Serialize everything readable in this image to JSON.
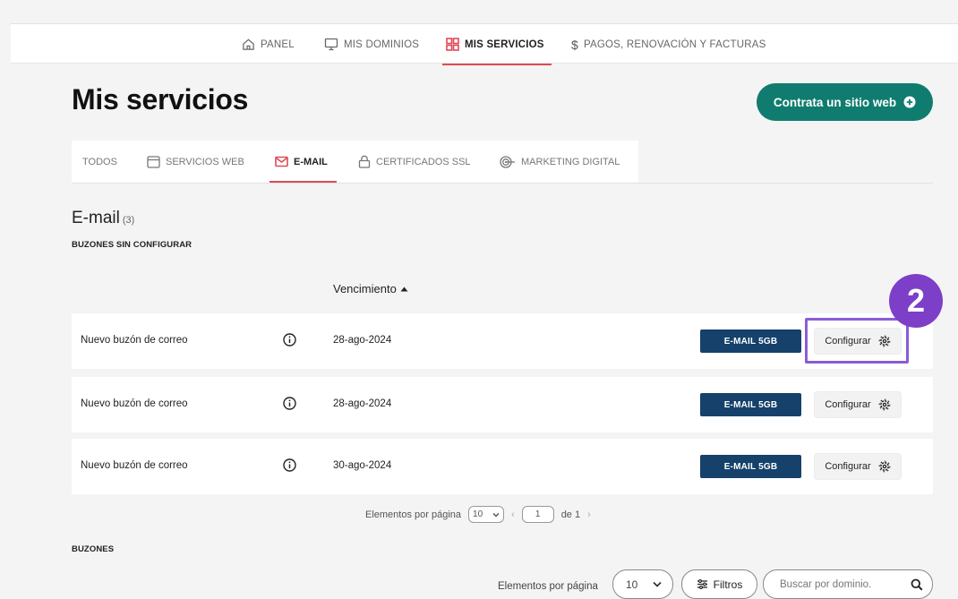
{
  "topnav": {
    "items": [
      {
        "label": "PANEL",
        "icon": "home-icon"
      },
      {
        "label": "MIS DOMINIOS",
        "icon": "monitor-icon"
      },
      {
        "label": "MIS SERVICIOS",
        "icon": "grid-icon",
        "active": true
      },
      {
        "label": "PAGOS, RENOVACIÓN Y FACTURAS",
        "icon": "dollar-icon"
      }
    ]
  },
  "header": {
    "title": "Mis servicios",
    "cta_label": "Contrata un sitio web"
  },
  "subtabs": [
    {
      "label": "TODOS"
    },
    {
      "label": "SERVICIOS WEB",
      "icon": "browser-icon"
    },
    {
      "label": "E-MAIL",
      "icon": "mail-icon",
      "active": true
    },
    {
      "label": "CERTIFICADOS SSL",
      "icon": "lock-icon"
    },
    {
      "label": "MARKETING DIGITAL",
      "icon": "target-icon"
    }
  ],
  "section": {
    "title": "E-mail",
    "count": "(3)",
    "unconfigured_heading": "BUZONES SIN CONFIGURAR",
    "mailboxes_heading": "BUZONES"
  },
  "table": {
    "column_expiry": "Vencimiento",
    "rows": [
      {
        "name": "Nuevo buzón de correo",
        "expiry": "28-ago-2024",
        "plan": "E-MAIL 5GB",
        "action": "Configurar"
      },
      {
        "name": "Nuevo buzón de correo",
        "expiry": "28-ago-2024",
        "plan": "E-MAIL 5GB",
        "action": "Configurar"
      },
      {
        "name": "Nuevo buzón de correo",
        "expiry": "30-ago-2024",
        "plan": "E-MAIL 5GB",
        "action": "Configurar"
      }
    ]
  },
  "pager": {
    "label": "Elementos por página",
    "per_page": "10",
    "page": "1",
    "of": "de 1"
  },
  "bottombar": {
    "label": "Elementos por página",
    "per_page": "10",
    "filter_label": "Filtros",
    "search_placeholder": "Buscar por dominio."
  },
  "annotation": {
    "step": "2"
  },
  "colors": {
    "accent_red": "#e04a57",
    "cta_green": "#0f7c6f",
    "plan_navy": "#15416b",
    "highlight_purple": "#8a5cd6",
    "step_purple": "#7d3fc8"
  }
}
